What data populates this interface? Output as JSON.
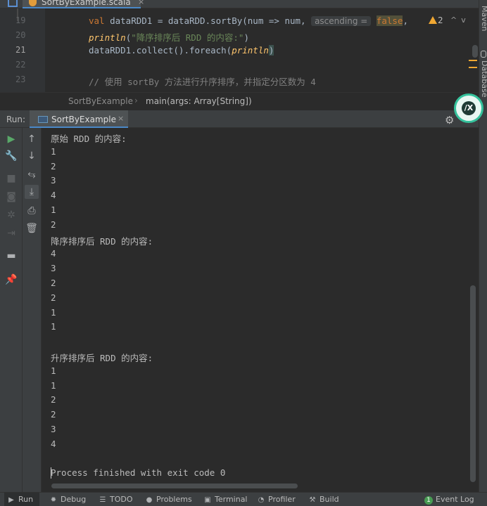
{
  "editor": {
    "file_tab": {
      "name": "SortByExample.scala",
      "close": "×"
    },
    "lines": [
      {
        "num": "19",
        "active": false
      },
      {
        "num": "20",
        "active": false
      },
      {
        "num": "21",
        "active": true
      },
      {
        "num": "22",
        "active": false
      },
      {
        "num": "23",
        "active": false
      }
    ],
    "line19": {
      "kw": "val",
      "ident": " dataRDD1 = dataRDD.sortBy(num => num, ",
      "hint": "ascending =",
      "bool": "false",
      "tail": ","
    },
    "line20": {
      "fn": "println",
      "open": "(",
      "str": "\"降序排序后 RDD 的内容:\"",
      "close": ")"
    },
    "line21": {
      "prefix": "dataRDD1.collect().foreach(",
      "fn": "println",
      "close": ")"
    },
    "line23": {
      "comment": "// 使用 sortBy 方法进行升序排序，并指定分区数为 4"
    },
    "warnings": {
      "count": "2",
      "up": "^",
      "down": "v"
    }
  },
  "right_strip": {
    "maven": "Maven",
    "database": "Database"
  },
  "breadcrumb": {
    "class_name": "SortByExample",
    "separator": "›",
    "method": "main(args: Array[String])"
  },
  "run_panel": {
    "label": "Run:",
    "tab": {
      "name": "SortByExample",
      "close": "×"
    },
    "avatar_text": "/X",
    "console_lines": [
      "原始 RDD 的内容:",
      "1",
      "2",
      "3",
      "4",
      "1",
      "2",
      "降序排序后 RDD 的内容:",
      "4",
      "3",
      "2",
      "2",
      "1",
      "1",
      "",
      "升序排序后 RDD 的内容:",
      "1",
      "1",
      "2",
      "2",
      "3",
      "4",
      "",
      "Process finished with exit code 0"
    ]
  },
  "status_bar": {
    "tabs": [
      {
        "icon": "▶",
        "label": "Run",
        "active": true
      },
      {
        "icon": "✹",
        "label": "Debug",
        "active": false
      },
      {
        "icon": "☰",
        "label": "TODO",
        "active": false
      },
      {
        "icon": "●",
        "label": "Problems",
        "active": false
      },
      {
        "icon": "▣",
        "label": "Terminal",
        "active": false
      },
      {
        "icon": "◔",
        "label": "Profiler",
        "active": false
      },
      {
        "icon": "⚒",
        "label": "Build",
        "active": false
      }
    ],
    "event_log": {
      "count": "1",
      "label": "Event Log"
    }
  },
  "colors": {
    "keyword": "#cc7832",
    "function": "#ffc66d",
    "string": "#6a8759",
    "comment": "#808080",
    "accent": "#4a88c7",
    "run_green": "#59a869",
    "warning": "#f0a732"
  }
}
